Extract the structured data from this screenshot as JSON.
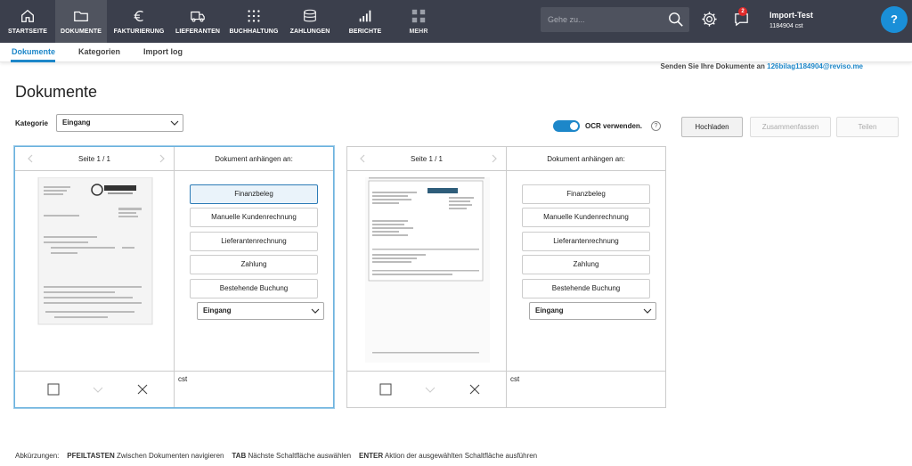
{
  "nav": {
    "items": [
      {
        "label": "STARTSEITE",
        "icon": "home-icon"
      },
      {
        "label": "DOKUMENTE",
        "icon": "folder-icon"
      },
      {
        "label": "FAKTURIERUNG",
        "icon": "euro-icon"
      },
      {
        "label": "LIEFERANTEN",
        "icon": "truck-icon"
      },
      {
        "label": "BUCHHALTUNG",
        "icon": "grid-icon"
      },
      {
        "label": "ZAHLUNGEN",
        "icon": "coins-icon"
      },
      {
        "label": "BERICHTE",
        "icon": "bar-chart-icon"
      },
      {
        "label": "MEHR",
        "icon": "apps-icon"
      }
    ],
    "search_placeholder": "Gehe zu...",
    "notification_count": "2",
    "account_name": "Import-Test",
    "account_sub": "1184904 cst",
    "help_label": "?"
  },
  "subnav": {
    "tabs": [
      "Dokumente",
      "Kategorien",
      "Import log"
    ]
  },
  "send_text": "Senden Sie Ihre Dokumente an",
  "send_email": "126bilag1184904@reviso.me",
  "page_title": "Dokumente",
  "kategorie_label": "Kategorie",
  "kategorie_value": "Eingang",
  "ocr_label": "OCR verwenden.",
  "ocr_enabled": true,
  "buttons": {
    "upload": "Hochladen",
    "merge": "Zusammenfassen",
    "share": "Teilen"
  },
  "cards": [
    {
      "page_label": "Seite 1 / 1",
      "attach_label": "Dokument anhängen an:",
      "options": [
        "Finanzbeleg",
        "Manuelle Kundenrechnung",
        "Lieferantenrechnung",
        "Zahlung",
        "Bestehende Buchung"
      ],
      "select_value": "Eingang",
      "note": "cst"
    },
    {
      "page_label": "Seite 1 / 1",
      "attach_label": "Dokument anhängen an:",
      "options": [
        "Finanzbeleg",
        "Manuelle Kundenrechnung",
        "Lieferantenrechnung",
        "Zahlung",
        "Bestehende Buchung"
      ],
      "select_value": "Eingang",
      "note": "cst"
    }
  ],
  "shortcuts": {
    "prefix": "Abkürzungen:",
    "k1": "PFEILTASTEN",
    "d1": "Zwischen Dokumenten navigieren",
    "k2": "TAB",
    "d2": "Nächste Schaltfläche auswählen",
    "k3": "ENTER",
    "d3": "Aktion der ausgewählten Schaltfläche ausführen"
  },
  "colors": {
    "topbar": "#3b3f4c",
    "accent": "#1d87c9",
    "badge": "#e02a2a",
    "help": "#1a8fd8"
  }
}
